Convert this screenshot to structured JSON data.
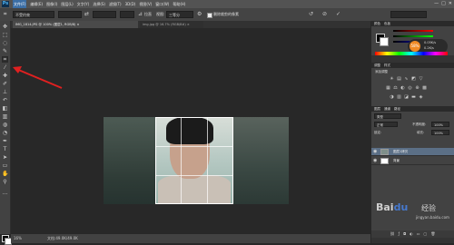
{
  "app": {
    "logo": "Ps",
    "menu": [
      "文件(F)",
      "编辑(E)",
      "图像(I)",
      "图层(L)",
      "文字(Y)",
      "选择(S)",
      "滤镜(T)",
      "3D(D)",
      "视图(V)",
      "窗口(W)",
      "帮助(H)"
    ],
    "active_menu_index": 0,
    "window_controls": [
      "—",
      "□",
      "✕"
    ]
  },
  "options_bar": {
    "ratio_select": "不受约束",
    "swap_icon": "⇄",
    "straighten_label": "拉直",
    "view_label": "视图:",
    "view_select": "三等分",
    "delete_pixels_label": "删除裁剪的像素",
    "delete_pixels_checked": true,
    "reset_icon": "↺",
    "cancel_icon": "⊘",
    "commit_icon": "✓"
  },
  "tabs": [
    {
      "label": "IMG_1814.JPG @ 100% (图层1, RGB/8) ×"
    },
    {
      "label": "img.jpg @ 16.7% (RGB/8#) ×"
    }
  ],
  "status": {
    "zoom": "16%",
    "doc_size": "文档:49.0K/49.0K"
  },
  "panels": {
    "color_tabs": [
      "颜色",
      "色板"
    ],
    "badge_value": "58%",
    "badge_stats": [
      "0.05K/s",
      "0.2K/s"
    ],
    "adjustments_tabs": [
      "调整",
      "样式"
    ],
    "adjustments_title": "添加调整",
    "layers_tabs": [
      "图层",
      "通道",
      "路径"
    ],
    "kind_select": "类型",
    "blend_mode": "正常",
    "opacity_label": "不透明度:",
    "opacity": "100%",
    "lock_label": "锁定:",
    "fill_label": "填充:",
    "fill": "100%",
    "layers": [
      {
        "name": "图层1拷贝",
        "selected": true
      },
      {
        "name": "背景",
        "selected": false
      }
    ]
  },
  "watermark": {
    "logo_a": "Bai",
    "logo_b": "du",
    "text": "经验",
    "url": "jingyan.baidu.com"
  },
  "colors": {
    "accent": "#3b6ea5",
    "selected_layer": "#5b6f86",
    "annotation_arrow": "#e02020",
    "badge": "#f08a24"
  }
}
